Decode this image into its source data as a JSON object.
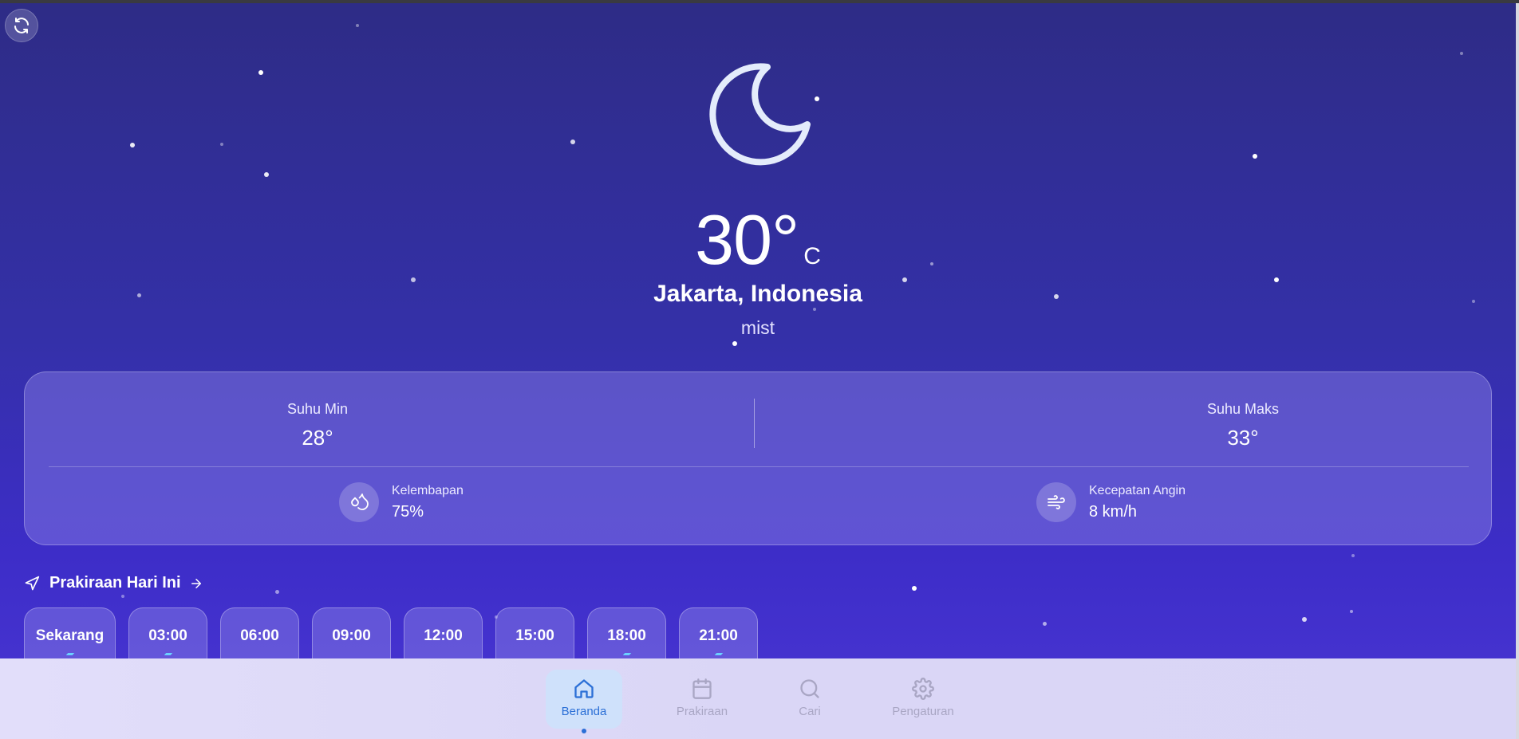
{
  "refresh": {
    "icon": "refresh-icon"
  },
  "current": {
    "icon": "moon-icon",
    "temperature": "30°",
    "unit": "C",
    "location": "Jakarta, Indonesia",
    "description": "mist"
  },
  "stats": {
    "min_label": "Suhu Min",
    "min_value": "28°",
    "max_label": "Suhu Maks",
    "max_value": "33°",
    "humidity_label": "Kelembapan",
    "humidity_value": "75%",
    "wind_label": "Kecepatan Angin",
    "wind_value": "8 km/h"
  },
  "forecast": {
    "title": "Prakiraan Hari Ini",
    "hours": [
      {
        "label": "Sekarang"
      },
      {
        "label": "03:00"
      },
      {
        "label": "06:00"
      },
      {
        "label": "09:00"
      },
      {
        "label": "12:00"
      },
      {
        "label": "15:00"
      },
      {
        "label": "18:00"
      },
      {
        "label": "21:00"
      }
    ]
  },
  "nav": {
    "items": [
      {
        "label": "Beranda",
        "icon": "home-icon",
        "active": true
      },
      {
        "label": "Prakiraan",
        "icon": "calendar-icon",
        "active": false
      },
      {
        "label": "Cari",
        "icon": "search-icon",
        "active": false
      },
      {
        "label": "Pengaturan",
        "icon": "gear-icon",
        "active": false
      }
    ]
  },
  "colors": {
    "accent": "#2b6fd6",
    "background_top": "#2e2c86",
    "background_bottom": "#4a36d4"
  }
}
